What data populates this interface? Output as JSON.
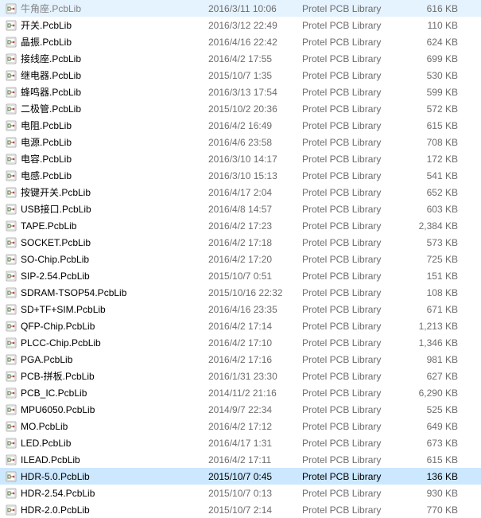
{
  "type_label": "Protel PCB Library",
  "files": [
    {
      "name": "牛角座.PcbLib",
      "date": "2016/3/11 10:06",
      "size": "616 KB",
      "cut": true
    },
    {
      "name": "开关.PcbLib",
      "date": "2016/3/12 22:49",
      "size": "110 KB"
    },
    {
      "name": "晶振.PcbLib",
      "date": "2016/4/16 22:42",
      "size": "624 KB"
    },
    {
      "name": "接线座.PcbLib",
      "date": "2016/4/2 17:55",
      "size": "699 KB"
    },
    {
      "name": "继电器.PcbLib",
      "date": "2015/10/7 1:35",
      "size": "530 KB"
    },
    {
      "name": "蜂鸣器.PcbLib",
      "date": "2016/3/13 17:54",
      "size": "599 KB"
    },
    {
      "name": "二极管.PcbLib",
      "date": "2015/10/2 20:36",
      "size": "572 KB"
    },
    {
      "name": "电阻.PcbLib",
      "date": "2016/4/2 16:49",
      "size": "615 KB"
    },
    {
      "name": "电源.PcbLib",
      "date": "2016/4/6 23:58",
      "size": "708 KB"
    },
    {
      "name": "电容.PcbLib",
      "date": "2016/3/10 14:17",
      "size": "172 KB"
    },
    {
      "name": "电感.PcbLib",
      "date": "2016/3/10 15:13",
      "size": "541 KB"
    },
    {
      "name": "按键开关.PcbLib",
      "date": "2016/4/17 2:04",
      "size": "652 KB"
    },
    {
      "name": "USB接口.PcbLib",
      "date": "2016/4/8 14:57",
      "size": "603 KB"
    },
    {
      "name": "TAPE.PcbLib",
      "date": "2016/4/2 17:23",
      "size": "2,384 KB"
    },
    {
      "name": "SOCKET.PcbLib",
      "date": "2016/4/2 17:18",
      "size": "573 KB"
    },
    {
      "name": "SO-Chip.PcbLib",
      "date": "2016/4/2 17:20",
      "size": "725 KB"
    },
    {
      "name": "SIP-2.54.PcbLib",
      "date": "2015/10/7 0:51",
      "size": "151 KB"
    },
    {
      "name": "SDRAM-TSOP54.PcbLib",
      "date": "2015/10/16 22:32",
      "size": "108 KB"
    },
    {
      "name": "SD+TF+SIM.PcbLib",
      "date": "2016/4/16 23:35",
      "size": "671 KB"
    },
    {
      "name": "QFP-Chip.PcbLib",
      "date": "2016/4/2 17:14",
      "size": "1,213 KB"
    },
    {
      "name": "PLCC-Chip.PcbLib",
      "date": "2016/4/2 17:10",
      "size": "1,346 KB"
    },
    {
      "name": "PGA.PcbLib",
      "date": "2016/4/2 17:16",
      "size": "981 KB"
    },
    {
      "name": "PCB-拼板.PcbLib",
      "date": "2016/1/31 23:30",
      "size": "627 KB"
    },
    {
      "name": "PCB_IC.PcbLib",
      "date": "2014/11/2 21:16",
      "size": "6,290 KB"
    },
    {
      "name": "MPU6050.PcbLib",
      "date": "2014/9/7 22:34",
      "size": "525 KB"
    },
    {
      "name": "MO.PcbLib",
      "date": "2016/4/2 17:12",
      "size": "649 KB"
    },
    {
      "name": "LED.PcbLib",
      "date": "2016/4/17 1:31",
      "size": "673 KB"
    },
    {
      "name": "ILEAD.PcbLib",
      "date": "2016/4/2 17:11",
      "size": "615 KB"
    },
    {
      "name": "HDR-5.0.PcbLib",
      "date": "2015/10/7 0:45",
      "size": "136 KB",
      "selected": true
    },
    {
      "name": "HDR-2.54.PcbLib",
      "date": "2015/10/7 0:13",
      "size": "930 KB"
    },
    {
      "name": "HDR-2.0.PcbLib",
      "date": "2015/10/7 2:14",
      "size": "770 KB"
    }
  ]
}
